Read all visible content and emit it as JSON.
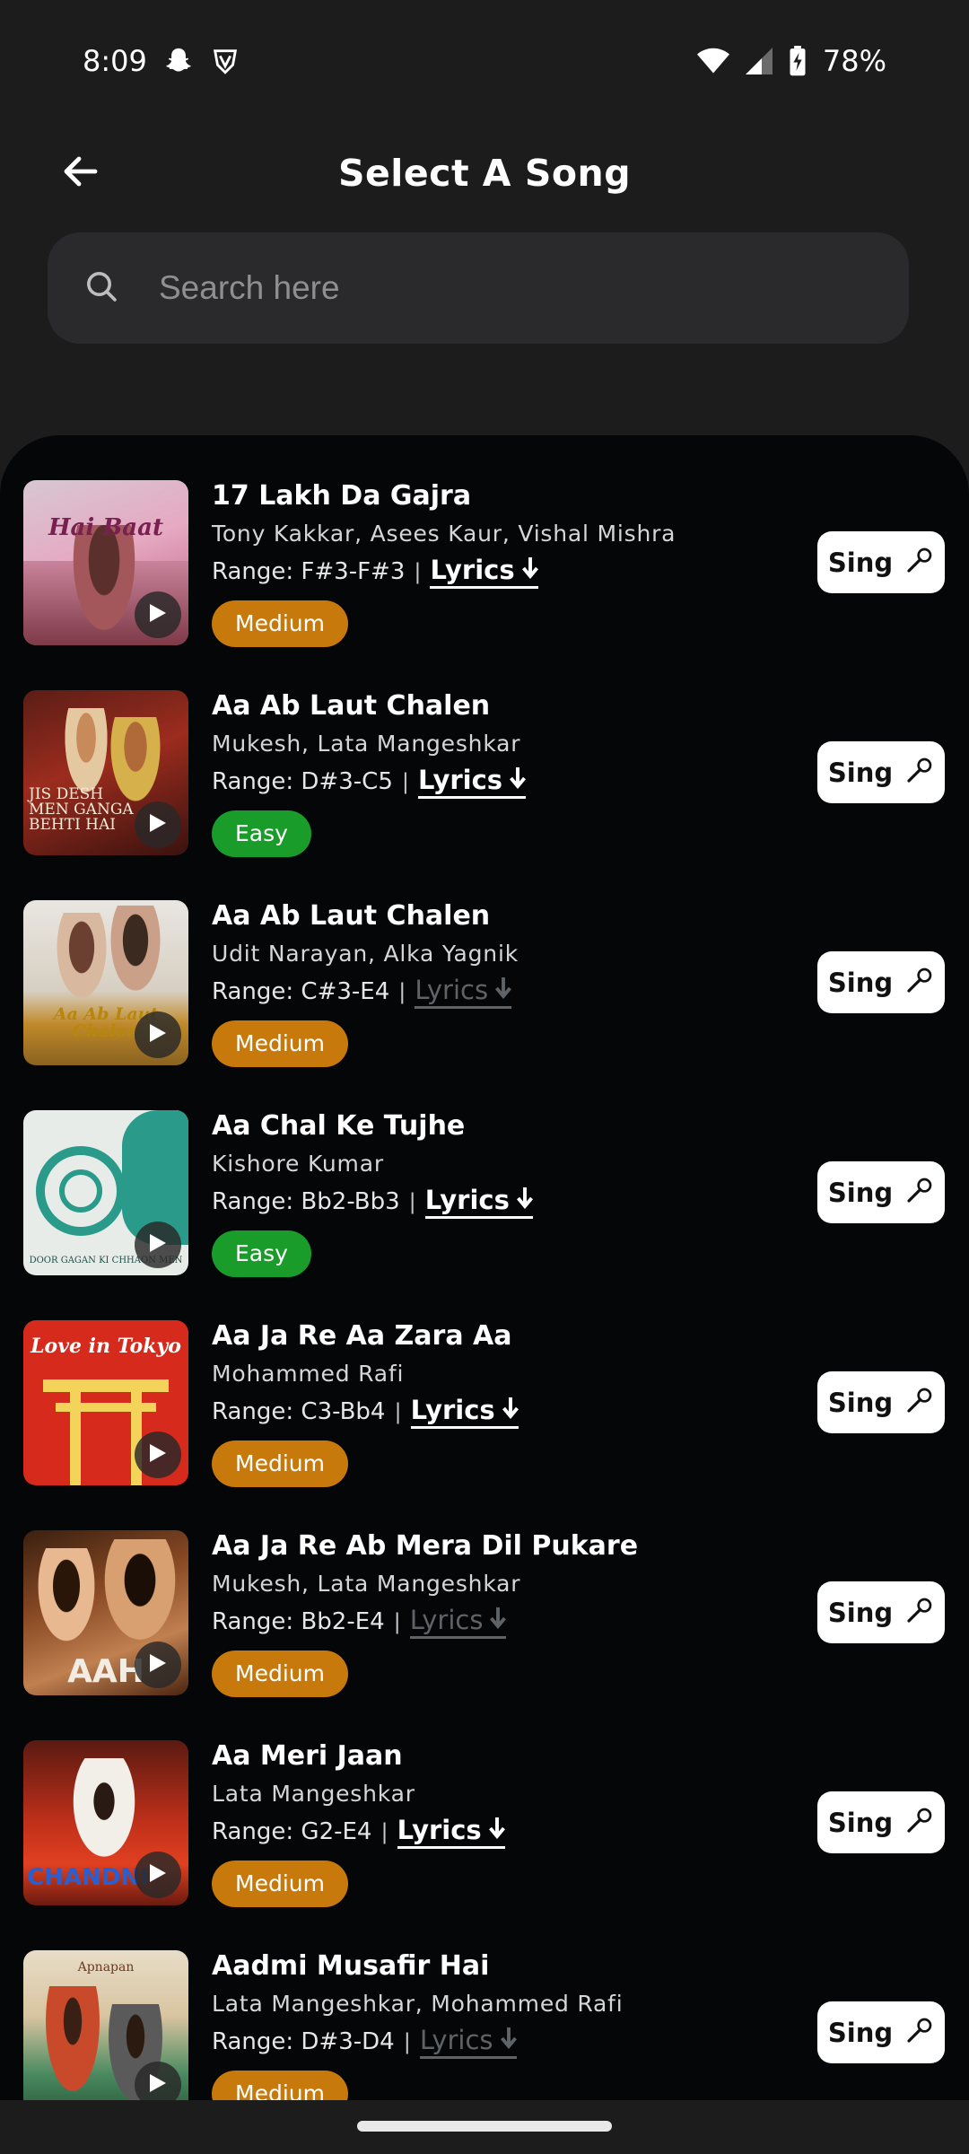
{
  "status_bar": {
    "time": "8:09",
    "battery": "78%",
    "icons": [
      "snapchat-icon",
      "shield-v-icon",
      "wifi-icon",
      "signal-icon",
      "battery-charging-icon"
    ]
  },
  "header": {
    "title": "Select A Song",
    "back_icon": "arrow-left-icon"
  },
  "search": {
    "placeholder": "Search here",
    "icon": "search-icon"
  },
  "sing_label": "Sing",
  "lyrics_label": "Lyrics",
  "songs": [
    {
      "title": "17 Lakh Da Gajra",
      "artists": "Tony Kakkar, Asees Kaur, Vishal Mishra",
      "range": "Range: F#3-F#3",
      "lyrics_available": true,
      "difficulty": "Medium",
      "art_text": "Hai Baat"
    },
    {
      "title": "Aa Ab Laut Chalen",
      "artists": "Mukesh, Lata Mangeshkar",
      "range": "Range: D#3-C5",
      "lyrics_available": true,
      "difficulty": "Easy",
      "art_text": "JIS DESH MEN GANGA BEHTI HAI"
    },
    {
      "title": "Aa Ab Laut Chalen",
      "artists": "Udit Narayan, Alka Yagnik",
      "range": "Range: C#3-E4",
      "lyrics_available": false,
      "difficulty": "Medium",
      "art_text": "Aa Ab Laut Chalen"
    },
    {
      "title": "Aa Chal Ke Tujhe",
      "artists": "Kishore Kumar",
      "range": "Range: Bb2-Bb3",
      "lyrics_available": true,
      "difficulty": "Easy",
      "art_text": "DOOR GAGAN KI CHHAON MEN"
    },
    {
      "title": "Aa Ja Re Aa Zara Aa",
      "artists": "Mohammed Rafi",
      "range": "Range: C3-Bb4",
      "lyrics_available": true,
      "difficulty": "Medium",
      "art_text": "Love in Tokyo"
    },
    {
      "title": "Aa Ja Re Ab Mera Dil Pukare",
      "artists": "Mukesh, Lata Mangeshkar",
      "range": "Range: Bb2-E4",
      "lyrics_available": false,
      "difficulty": "Medium",
      "art_text": "AAH"
    },
    {
      "title": "Aa Meri Jaan",
      "artists": "Lata Mangeshkar",
      "range": "Range: G2-E4",
      "lyrics_available": true,
      "difficulty": "Medium",
      "art_text": "CHANDNI"
    },
    {
      "title": "Aadmi Musafir Hai",
      "artists": "Lata Mangeshkar, Mohammed Rafi",
      "range": "Range: D#3-D4",
      "lyrics_available": false,
      "difficulty": "Medium",
      "art_text": "Apnapan"
    }
  ],
  "colors": {
    "background": "#1c1c1d",
    "list_background": "#050608",
    "medium_badge": "#c77a0b",
    "easy_badge": "#1a9c2a",
    "lyrics_disabled": "#5e6368"
  }
}
